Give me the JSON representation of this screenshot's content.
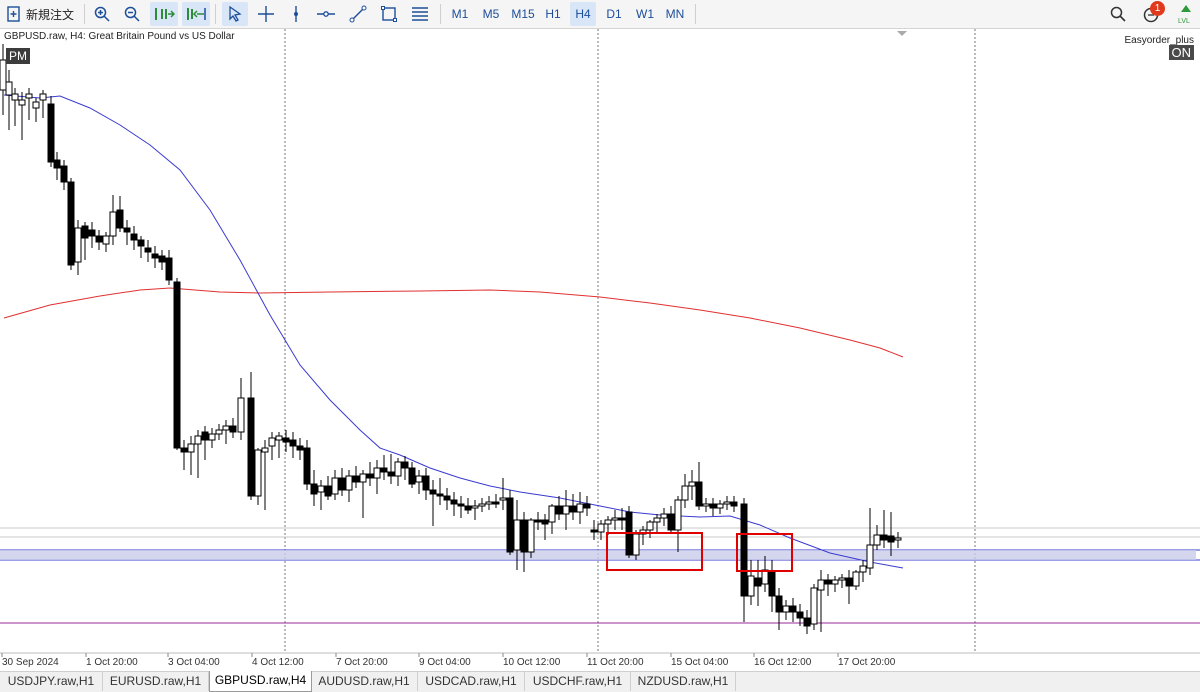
{
  "toolbar": {
    "new_order_label": "新規注文",
    "tools": [
      "zoom-in-icon",
      "zoom-out-icon",
      "autoscroll-icon",
      "chart-shift-icon",
      "cursor-icon",
      "crosshair-icon",
      "vertical-line-icon",
      "horizontal-line-icon",
      "trendline-icon",
      "rectangle-icon",
      "fibonacci-icon"
    ],
    "timeframes": [
      "M1",
      "M5",
      "M15",
      "H1",
      "H4",
      "D1",
      "W1",
      "MN"
    ],
    "active_timeframe": "H4",
    "notification_count": "1"
  },
  "chart": {
    "title": "GBPUSD.raw, H4:  Great Britain Pound vs US Dollar",
    "session_badge": "PM",
    "ea_name": "Easyorder_plus",
    "ea_state": "ON",
    "x_labels": [
      "30 Sep 2024",
      "1 Oct 20:00",
      "3 Oct 04:00",
      "4 Oct 12:00",
      "7 Oct 20:00",
      "9 Oct 04:00",
      "10 Oct 12:00",
      "11 Oct 20:00",
      "15 Oct 04:00",
      "16 Oct 12:00",
      "17 Oct 20:00"
    ],
    "colors": {
      "ma_fast": "#3a3ad0",
      "ma_slow": "#e03030",
      "zone": "#c8cce8",
      "box": "#e00000",
      "bull": "#ffffff",
      "bear": "#000000"
    }
  },
  "tabs": [
    "USDJPY.raw,H1",
    "EURUSD.raw,H1",
    "GBPUSD.raw,H4",
    "AUDUSD.raw,H1",
    "USDCAD.raw,H1",
    "USDCHF.raw,H1",
    "NZDUSD.raw,H1"
  ],
  "active_tab": "GBPUSD.raw,H4"
}
